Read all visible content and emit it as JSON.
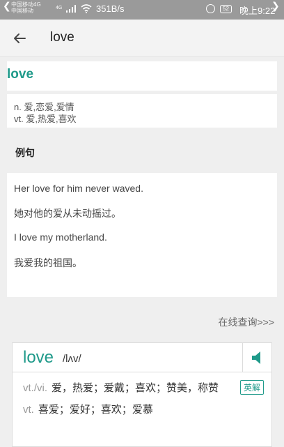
{
  "status_bar": {
    "carrier_1": "中国移动4G",
    "carrier_2": "中国移动",
    "net_small": "4G",
    "speed": "351B/s",
    "battery": "52",
    "time": "晚上9:22"
  },
  "app_bar": {
    "title": "love",
    "back_icon": "arrow-left-icon"
  },
  "word": "love",
  "definitions": [
    "n. 爱,恋爱,爱情",
    "vt. 爱,热爱,喜欢"
  ],
  "examples_section": {
    "label": "例句",
    "lines": [
      "Her love for him never waved.",
      "她对他的爱从未动摇过。",
      "I love my motherland.",
      "我爱我的祖国。"
    ]
  },
  "online_query": "在线查询>>>",
  "dictionary_popup": {
    "word": "love",
    "phonetic": "/lʌv/",
    "speaker_icon": "speaker-icon",
    "entries": [
      {
        "pos": "vt./vi.",
        "meaning": "爱，热爱；爱戴；喜欢；赞美，称赞"
      },
      {
        "pos": "vt.",
        "meaning": "喜爱；爱好；喜欢；爱慕"
      }
    ],
    "en_cn_button": "英解"
  },
  "colors": {
    "accent": "#1f9a8a",
    "status_bar": "#9a9a9a"
  }
}
